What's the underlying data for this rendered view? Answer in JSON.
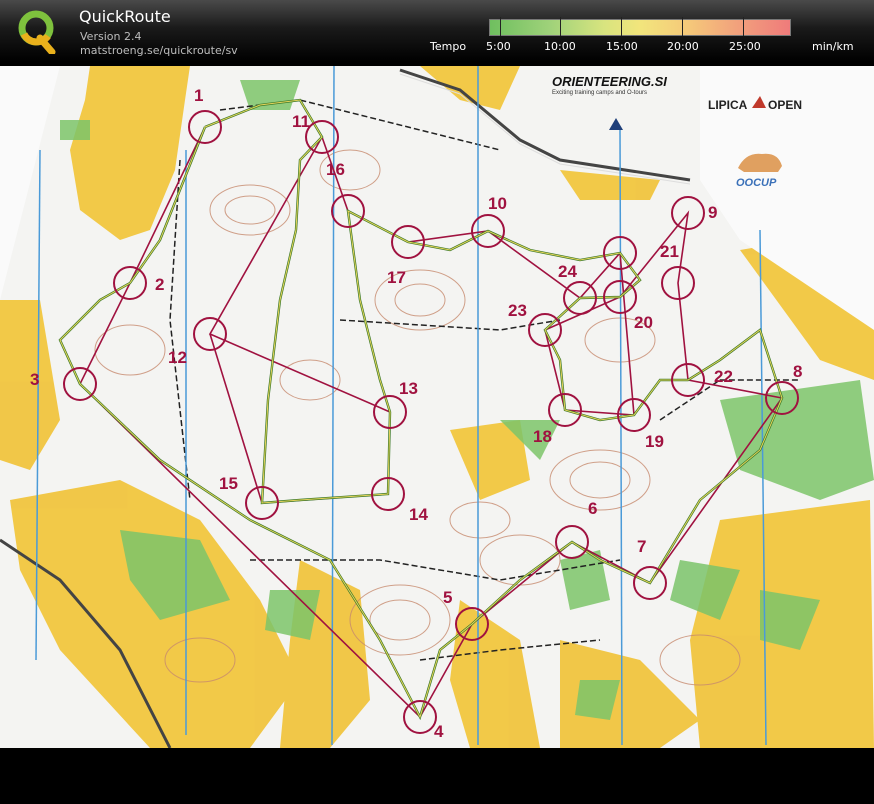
{
  "app": {
    "title": "QuickRoute",
    "version": "Version 2.4",
    "url": "matstroeng.se/quickroute/sv"
  },
  "tempo": {
    "label": "Tempo",
    "unit": "min/km",
    "scale": [
      "5:00",
      "10:00",
      "15:00",
      "20:00",
      "25:00"
    ]
  },
  "map": {
    "logos": {
      "orienteering_title": "ORIENTEERING.SI",
      "orienteering_subtitle": "Exciting training camps and O-tours",
      "lipica": "LIPICA",
      "open": "OPEN",
      "oocup": "OOCUP"
    },
    "controls": [
      {
        "number": "1"
      },
      {
        "number": "2"
      },
      {
        "number": "3"
      },
      {
        "number": "4"
      },
      {
        "number": "5"
      },
      {
        "number": "6"
      },
      {
        "number": "7"
      },
      {
        "number": "8"
      },
      {
        "number": "9"
      },
      {
        "number": "10"
      },
      {
        "number": "11"
      },
      {
        "number": "12"
      },
      {
        "number": "13"
      },
      {
        "number": "14"
      },
      {
        "number": "15"
      },
      {
        "number": "16"
      },
      {
        "number": "17"
      },
      {
        "number": "18"
      },
      {
        "number": "19"
      },
      {
        "number": "20"
      },
      {
        "number": "21"
      },
      {
        "number": "22"
      },
      {
        "number": "23"
      },
      {
        "number": "24"
      }
    ]
  },
  "colors": {
    "control": "#a01240",
    "route": "#3d7a2a",
    "yellow": "#f1c43a",
    "green": "#7cc46a",
    "north_lines": "#4a9ad8"
  },
  "icons": {
    "logo": "quickroute-q-logo",
    "north_arrow": "north-arrow-icon",
    "bear": "bear-icon"
  }
}
